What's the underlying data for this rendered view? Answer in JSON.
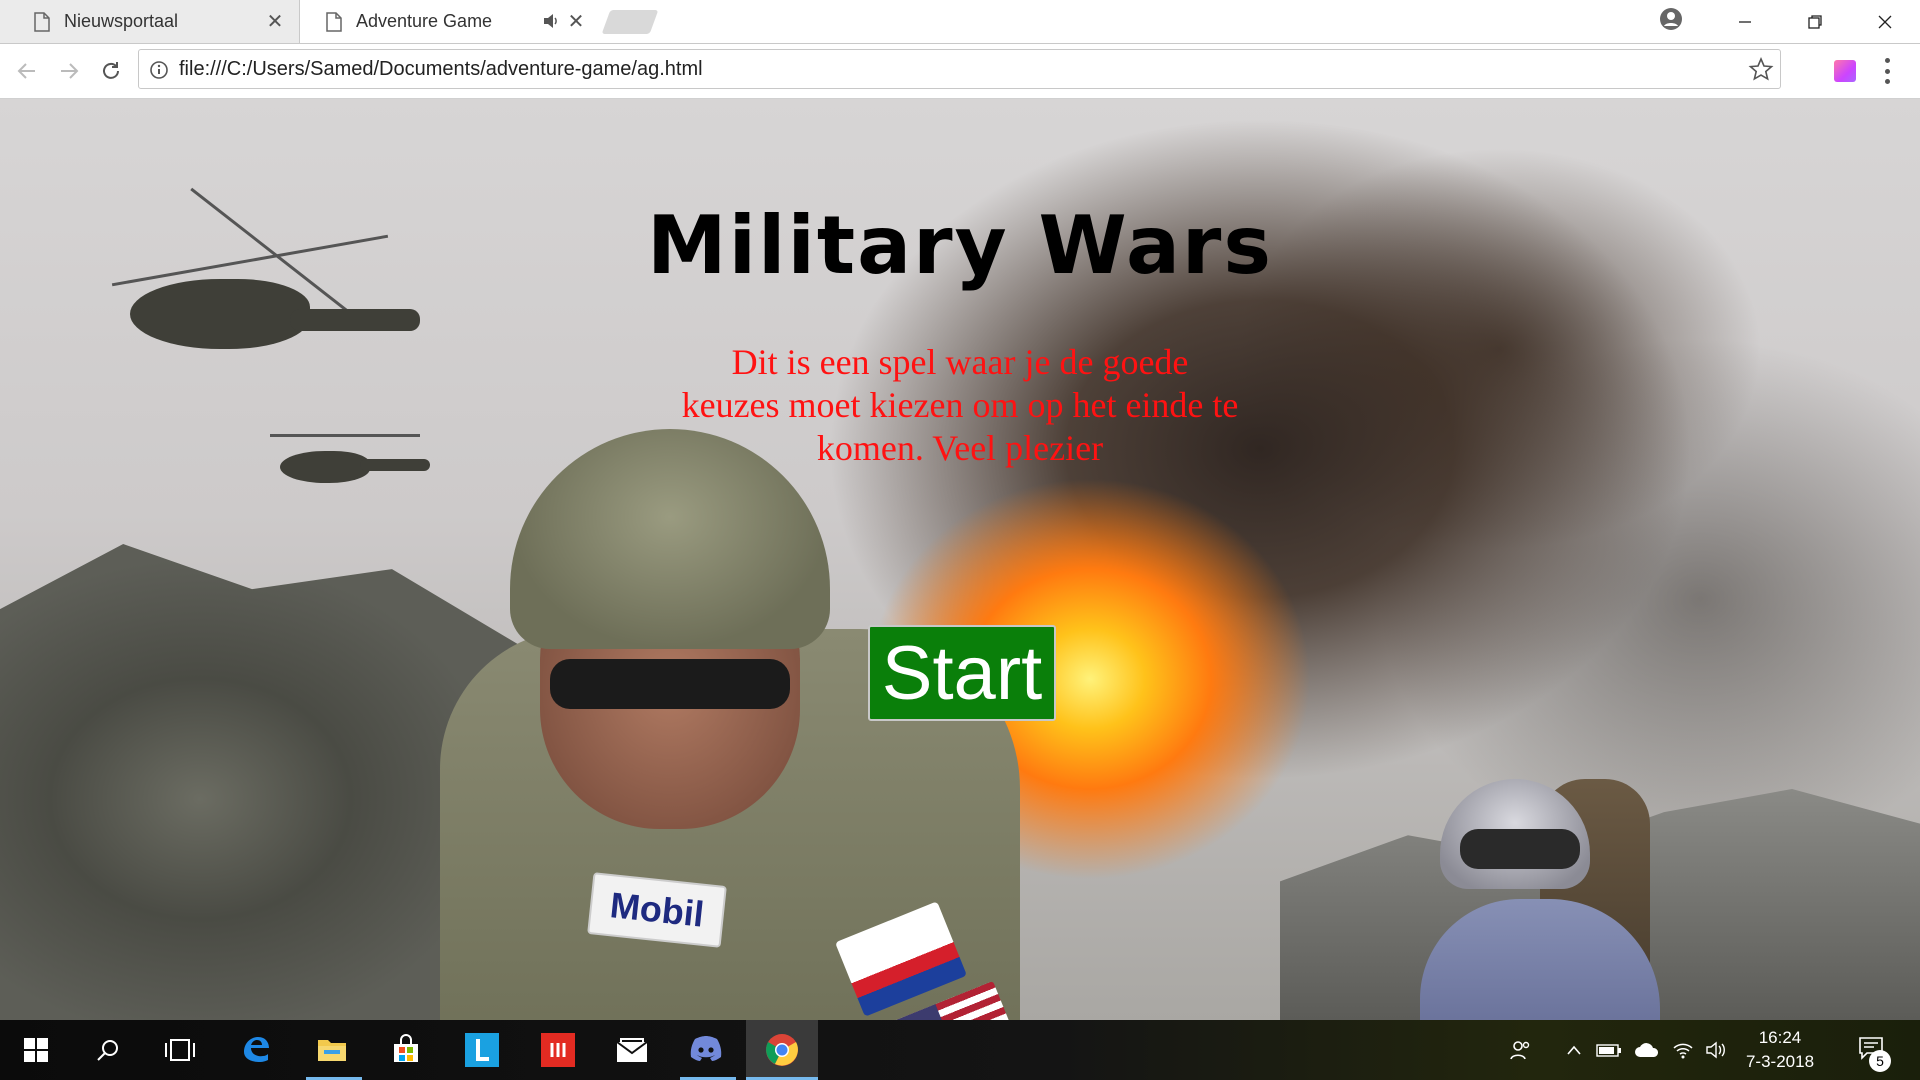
{
  "browser": {
    "tabs": [
      {
        "label": "Nieuwsportaal",
        "active": false
      },
      {
        "label": "Adventure Game",
        "active": true,
        "audio": true
      }
    ],
    "address_bar": {
      "url": "file:///C:/Users/Samed/Documents/adventure-game/ag.html"
    }
  },
  "page": {
    "title": "Military Wars",
    "description": "Dit is een spel waar je de goede keuzes moet kiezen om op het einde te komen. Veel plezier",
    "start_button": "Start",
    "colors": {
      "title": "#000000",
      "description": "#ff1212",
      "start_button_bg": "#0a7f0a"
    }
  },
  "taskbar": {
    "apps": [
      "windows-start",
      "search",
      "task-view",
      "edge",
      "file-explorer",
      "store",
      "l-app",
      "red-app",
      "mail",
      "discord",
      "chrome"
    ],
    "active_app": "chrome",
    "clock": {
      "time": "16:24",
      "date": "7-3-2018"
    },
    "notification_count": "5"
  }
}
